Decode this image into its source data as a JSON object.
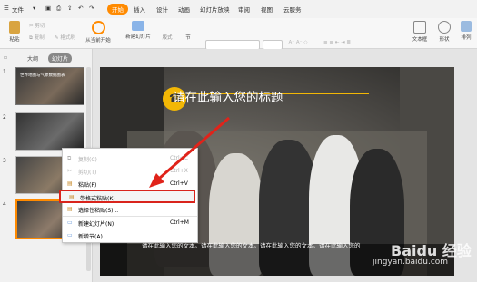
{
  "menubar": {
    "file": "文件",
    "tabs": [
      "开始",
      "插入",
      "设计",
      "动画",
      "幻灯片放映",
      "审阅",
      "视图",
      "云服务"
    ],
    "active_tab": "开始"
  },
  "ribbon": {
    "paste": "粘贴",
    "cut": "剪切",
    "copy": "复制",
    "format_painter": "格式刷",
    "play_from_current": "从当前开始",
    "new_slide": "新建幻灯片",
    "layout": "版式",
    "section": "节",
    "textbox": "文本框",
    "shape": "形状",
    "arrange": "排列"
  },
  "left_pane": {
    "tabs": [
      "大纲",
      "幻灯片"
    ],
    "active_tab": "幻灯片",
    "slide_numbers": [
      "1",
      "2",
      "3",
      "4"
    ],
    "thumb1_title": "世界地图与气象数据图表"
  },
  "slide": {
    "title": "请在此输入您的标题",
    "body": "请在此输入您的文本。请在此输入您的文本。请在此输入您的文本。请在此输入您的"
  },
  "context_menu": {
    "items": [
      {
        "label": "复制(C)",
        "shortcut": "Ctrl+C",
        "enabled": false
      },
      {
        "label": "剪切(T)",
        "shortcut": "Ctrl+X",
        "enabled": false
      },
      {
        "label": "粘贴(P)",
        "shortcut": "Ctrl+V",
        "enabled": true
      },
      {
        "label": "带格式粘贴(K)",
        "shortcut": "",
        "enabled": true,
        "highlighted": true
      },
      {
        "label": "选择性粘贴(S)...",
        "shortcut": "",
        "enabled": true
      },
      {
        "label": "新建幻灯片(N)",
        "shortcut": "Ctrl+M",
        "enabled": true
      },
      {
        "label": "新增节(A)",
        "shortcut": "",
        "enabled": true
      }
    ]
  },
  "watermark": {
    "line1": "Baidu 经验",
    "line2": "jingyan.baidu.com"
  },
  "colors": {
    "accent": "#ff8a00",
    "highlight_border": "#d9241c",
    "title_circle": "#f2b705"
  }
}
